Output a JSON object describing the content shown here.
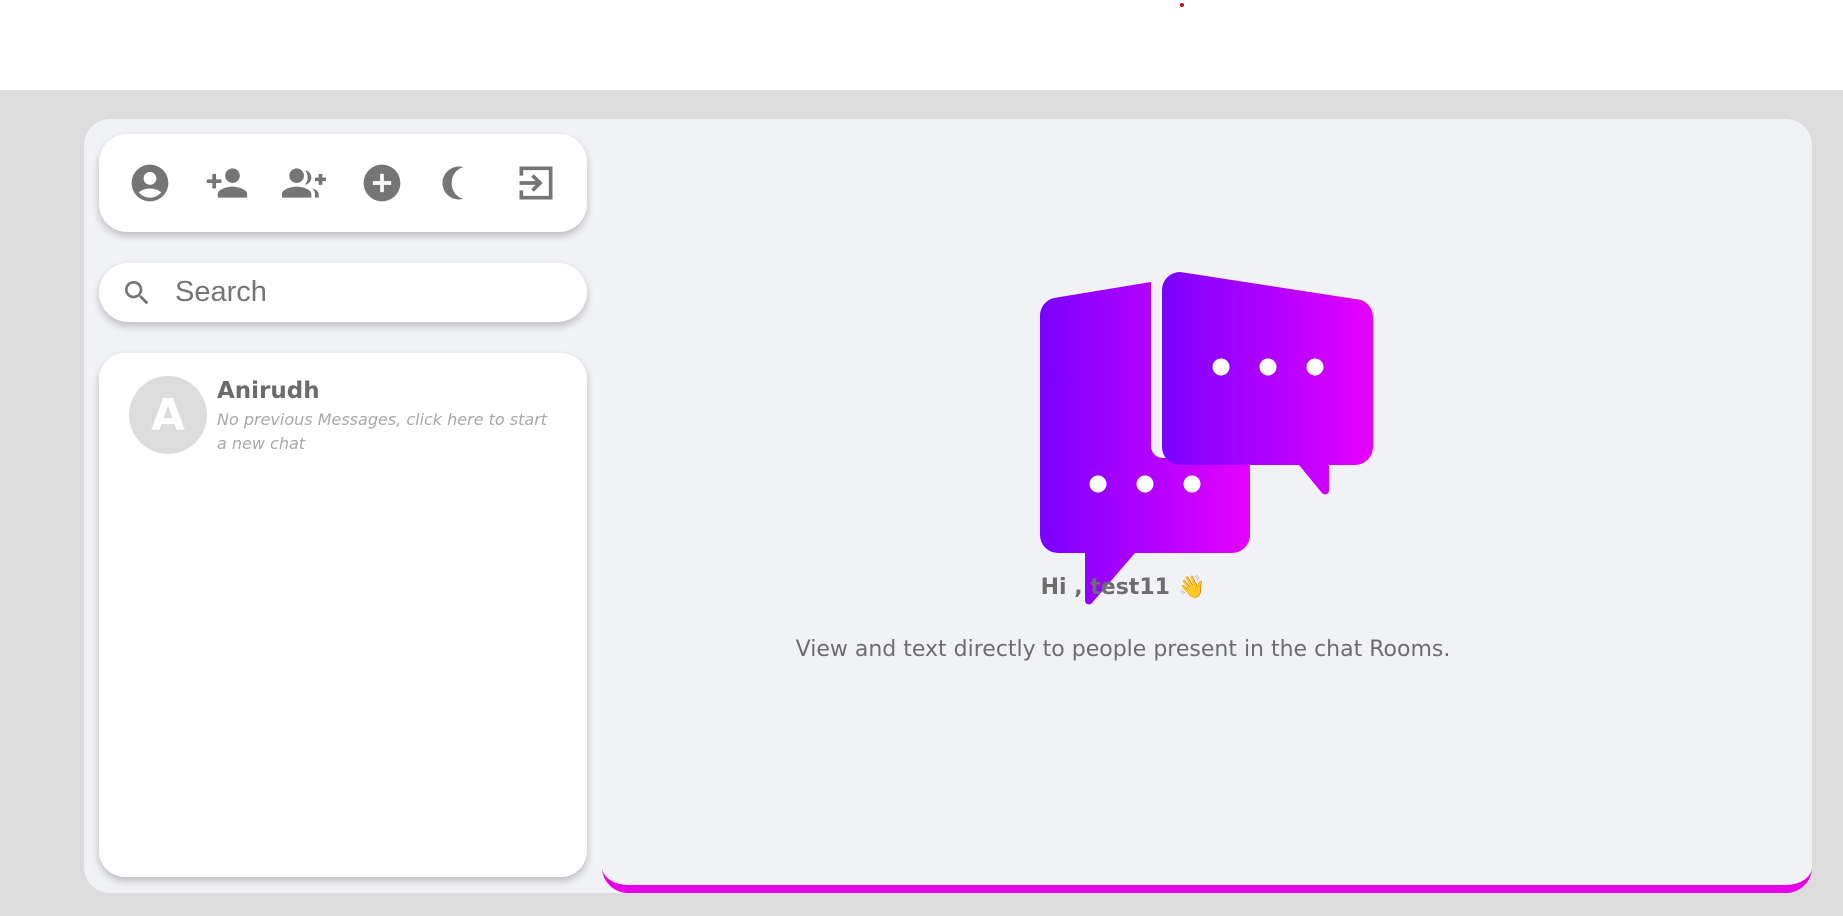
{
  "toolbar": {
    "buttons": [
      {
        "icon": "account-circle-icon"
      },
      {
        "icon": "person-add-icon"
      },
      {
        "icon": "group-add-icon"
      },
      {
        "icon": "add-circle-icon"
      },
      {
        "icon": "dark-mode-icon"
      },
      {
        "icon": "logout-icon"
      }
    ]
  },
  "search": {
    "placeholder": "Search",
    "icon": "search-icon"
  },
  "chats": [
    {
      "avatar_letter": "A",
      "name": "Anirudh",
      "preview": "No previous Messages, click here to start a new chat"
    }
  ],
  "welcome": {
    "greeting": "Hi , test11",
    "wave": "👋",
    "subtitle": "View and text directly to people present in the chat Rooms.",
    "illustration": "chat-bubbles-icon"
  },
  "colors": {
    "accent": "#e600ea",
    "gradient_start": "#7a00ff",
    "gradient_end": "#e600ff",
    "icon_gray": "#757575",
    "page_bg": "#dcdcdc",
    "panel_bg": "#f1f2f6"
  }
}
